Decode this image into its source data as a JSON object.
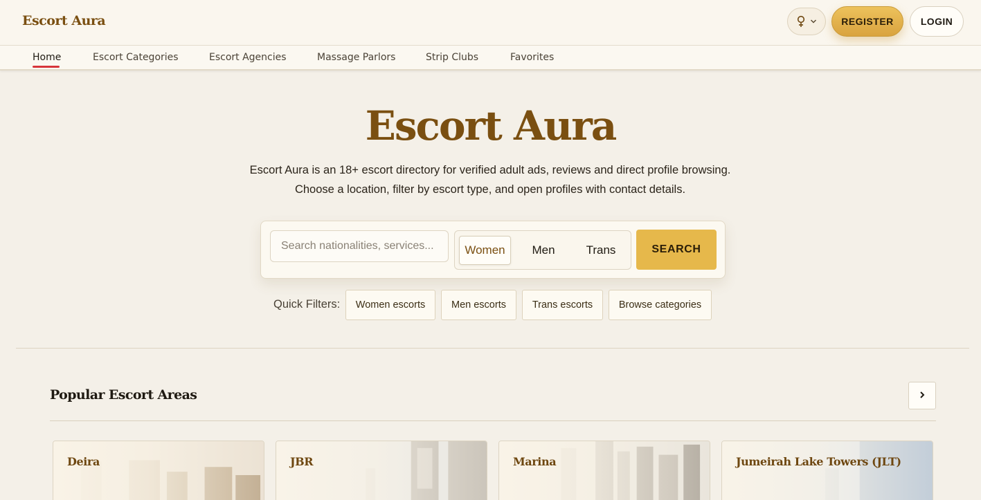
{
  "header": {
    "brand": "Escort Aura",
    "gender_icon": "female-symbol-icon",
    "register_label": "REGISTER",
    "login_label": "LOGIN"
  },
  "nav": {
    "items": [
      {
        "label": "Home",
        "active": true
      },
      {
        "label": "Escort Categories"
      },
      {
        "label": "Escort Agencies"
      },
      {
        "label": "Massage Parlors"
      },
      {
        "label": "Strip Clubs"
      },
      {
        "label": "Favorites"
      }
    ]
  },
  "hero": {
    "title": "Escort Aura",
    "description": "Escort Aura is an 18+ escort directory for verified adult ads, reviews and direct profile browsing. Choose a location, filter by escort type, and open profiles with contact details."
  },
  "search": {
    "placeholder": "Search nationalities, services...",
    "types": [
      "Women",
      "Men",
      "Trans"
    ],
    "selected_type": "Women",
    "button_label": "SEARCH"
  },
  "quick_filters": {
    "label": "Quick Filters:",
    "chips": [
      "Women escorts",
      "Men escorts",
      "Trans escorts",
      "Browse categories"
    ]
  },
  "popular_areas": {
    "title": "Popular Escort Areas",
    "next_icon": "chevron-right-icon",
    "areas": [
      {
        "name": "Deira"
      },
      {
        "name": "JBR"
      },
      {
        "name": "Marina"
      },
      {
        "name": "Jumeirah Lake Towers (JLT)"
      }
    ]
  },
  "colors": {
    "brand": "#7a4f11",
    "accent": "#e6b84b",
    "active_underline": "#d7353a",
    "background": "#f4f0e8"
  }
}
